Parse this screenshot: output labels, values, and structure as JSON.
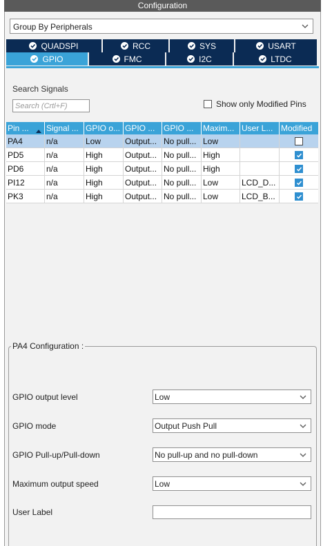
{
  "window": {
    "title": "Configuration"
  },
  "group_by": {
    "value": "Group By Peripherals"
  },
  "tabs_row1": [
    {
      "label": "QUADSPI"
    },
    {
      "label": "RCC"
    },
    {
      "label": "SYS"
    },
    {
      "label": "USART"
    }
  ],
  "tabs_row2": [
    {
      "label": "GPIO",
      "active": true
    },
    {
      "label": "FMC"
    },
    {
      "label": "I2C"
    },
    {
      "label": "LTDC"
    }
  ],
  "search": {
    "label": "Search Signals",
    "placeholder": "Search (Crtl+F)",
    "show_modified_label": "Show only Modified Pins"
  },
  "table": {
    "headers": [
      "Pin ...",
      "Signal ...",
      "GPIO o...",
      "GPIO ...",
      "GPIO ...",
      "Maxim...",
      "User L...",
      "Modified"
    ],
    "rows": [
      {
        "pin": "PA4",
        "signal": "n/a",
        "output": "Low",
        "mode": "Output...",
        "pull": "No pull...",
        "speed": "Low",
        "label": "",
        "modified": false
      },
      {
        "pin": "PD5",
        "signal": "n/a",
        "output": "High",
        "mode": "Output...",
        "pull": "No pull...",
        "speed": "High",
        "label": "",
        "modified": true
      },
      {
        "pin": "PD6",
        "signal": "n/a",
        "output": "High",
        "mode": "Output...",
        "pull": "No pull...",
        "speed": "High",
        "label": "",
        "modified": true
      },
      {
        "pin": "PI12",
        "signal": "n/a",
        "output": "High",
        "mode": "Output...",
        "pull": "No pull...",
        "speed": "Low",
        "label": "LCD_D...",
        "modified": true
      },
      {
        "pin": "PK3",
        "signal": "n/a",
        "output": "High",
        "mode": "Output...",
        "pull": "No pull...",
        "speed": "Low",
        "label": "LCD_B...",
        "modified": true
      }
    ]
  },
  "config": {
    "legend": "PA4 Configuration :",
    "output_level": {
      "label": "GPIO output level",
      "value": "Low"
    },
    "mode": {
      "label": "GPIO mode",
      "value": "Output Push Pull"
    },
    "pull": {
      "label": "GPIO Pull-up/Pull-down",
      "value": "No pull-up and no pull-down"
    },
    "speed": {
      "label": "Maximum output speed",
      "value": "Low"
    },
    "user_label": {
      "label": "User Label",
      "value": ""
    }
  },
  "colors": {
    "tab_dark": "#0b2b54",
    "tab_active": "#3aa3d8",
    "selected_row": "#b8d3ee"
  }
}
